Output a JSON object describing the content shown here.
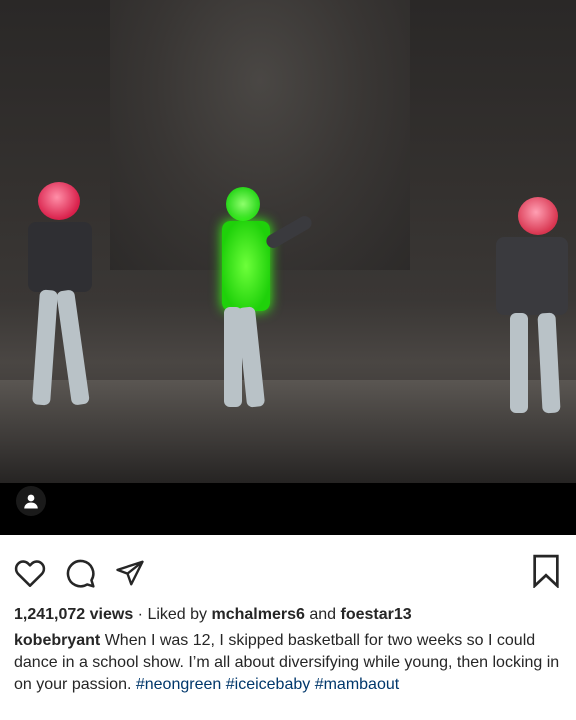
{
  "video": {
    "user_tag_icon": "person-icon"
  },
  "actions": {
    "like_icon": "heart-icon",
    "comment_icon": "comment-icon",
    "share_icon": "paper-plane-icon",
    "save_icon": "bookmark-icon"
  },
  "stats": {
    "views": "1,241,072 views",
    "separator": "·",
    "liked_by_label": "Liked by",
    "liked_user": "mchalmers6",
    "and_label": "and",
    "other_user": "foestar13"
  },
  "caption": {
    "username": "kobebryant",
    "text": "When I was 12, I skipped basketball for two weeks so I could dance in a school show. I’m all about diversifying while young, then locking in on your passion.",
    "hashtags": [
      "#neongreen",
      "#iceicebaby",
      "#mambaout"
    ]
  },
  "colors": {
    "neon_green": "#39ff14",
    "helmet_red": "#e8485f",
    "link": "#00376b"
  }
}
